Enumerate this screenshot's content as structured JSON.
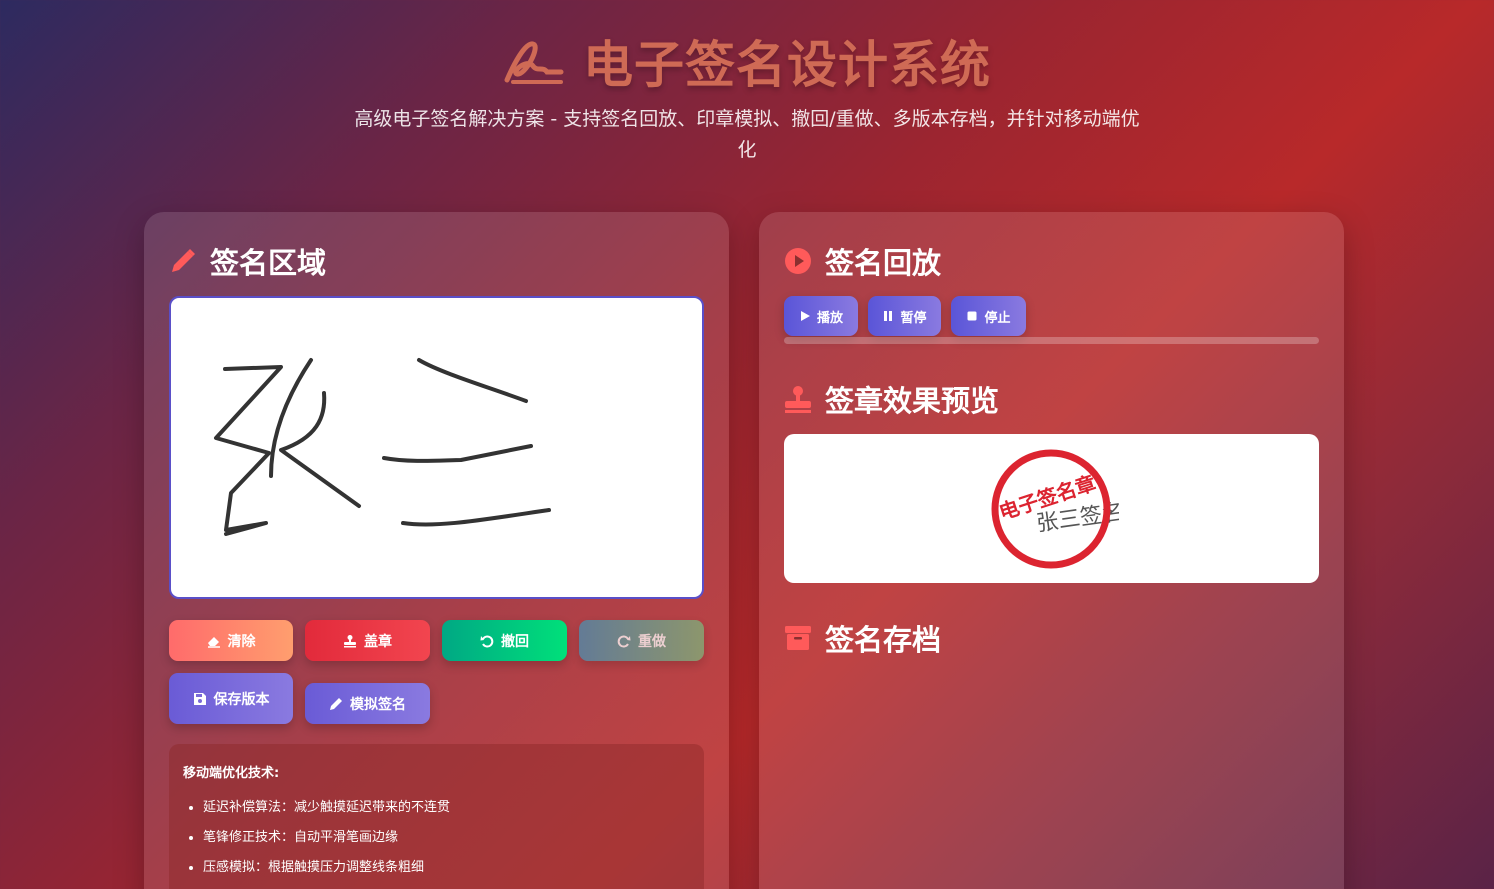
{
  "header": {
    "title": "电子签名设计系统",
    "subtitle": "高级电子签名解决方案 - 支持签名回放、印章模拟、撤回/重做、多版本存档，并针对移动端优化"
  },
  "signature_panel": {
    "title": "签名区域",
    "buttons": {
      "clear": "清除",
      "stamp": "盖章",
      "undo": "撤回",
      "redo": "重做",
      "save_version": "保存版本",
      "simulate": "模拟签名"
    },
    "tips": {
      "title": "移动端优化技术:",
      "items": [
        "延迟补偿算法：减少触摸延迟带来的不连贯",
        "笔锋修正技术：自动平滑笔画边缘",
        "压感模拟：根据触摸压力调整线条粗细"
      ]
    }
  },
  "playback_panel": {
    "title": "签名回放",
    "buttons": {
      "play": "播放",
      "pause": "暂停",
      "stop": "停止"
    },
    "progress_percent": 0
  },
  "stamp_preview": {
    "title": "签章效果预览",
    "seal_text": "电子签名章",
    "signature_text": "张三签名"
  },
  "archive": {
    "title": "签名存档"
  },
  "colors": {
    "accent_red": "#ff5a5a",
    "seal_red": "#dc2430",
    "canvas_border": "#5a4fc8"
  },
  "icons": {
    "title": "signature-icon",
    "signature_area": "pencil-icon",
    "playback": "play-circle-icon",
    "stamp": "stamp-icon",
    "archive": "archive-box-icon"
  }
}
